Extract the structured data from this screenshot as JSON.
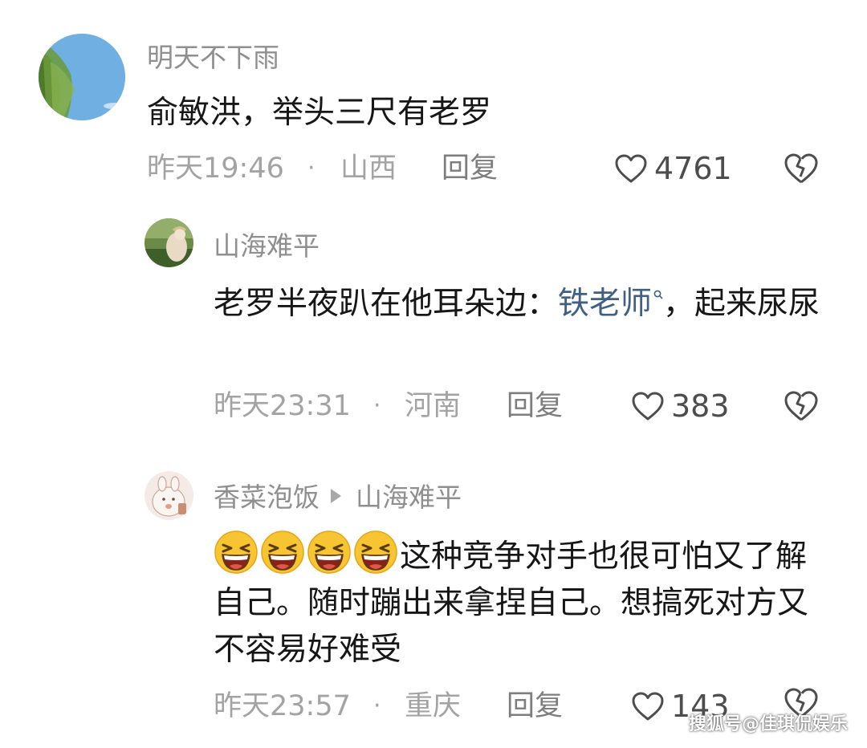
{
  "comments": [
    {
      "username": "明天不下雨",
      "text": "俞敏洪，举头三尺有老罗",
      "time": "昨天19:46",
      "separator": "·",
      "location": "山西",
      "reply_label": "回复",
      "likes": "4761"
    },
    {
      "username": "山海难平",
      "text_before": "老罗半夜趴在他耳朵边：",
      "link_text": "铁老师",
      "text_after": "，起来尿尿",
      "time": "昨天23:31",
      "separator": "·",
      "location": "河南",
      "reply_label": "回复",
      "likes": "383"
    },
    {
      "username": "香菜泡饭",
      "reply_to": "山海难平",
      "emoji_count": 4,
      "text": "这种竞争对手也很可怕又了解自己。随时蹦出来拿捏自己。想搞死对方又不容易好难受",
      "time": "昨天23:57",
      "separator": "·",
      "location": "重庆",
      "reply_label": "回复",
      "likes": "143"
    }
  ],
  "icons": {
    "like": "heart-outline-icon",
    "dislike": "broken-heart-icon",
    "reply_arrow": "triangle-right-icon",
    "emoji": "laughing-emoji-icon",
    "link_search": "search-magnifier-icon"
  },
  "colors": {
    "name": "#8f8f8f",
    "text": "#161616",
    "meta": "#a3a3a3",
    "link": "#3f5f85"
  },
  "watermark": "搜狐号@佳琪侃娱乐"
}
